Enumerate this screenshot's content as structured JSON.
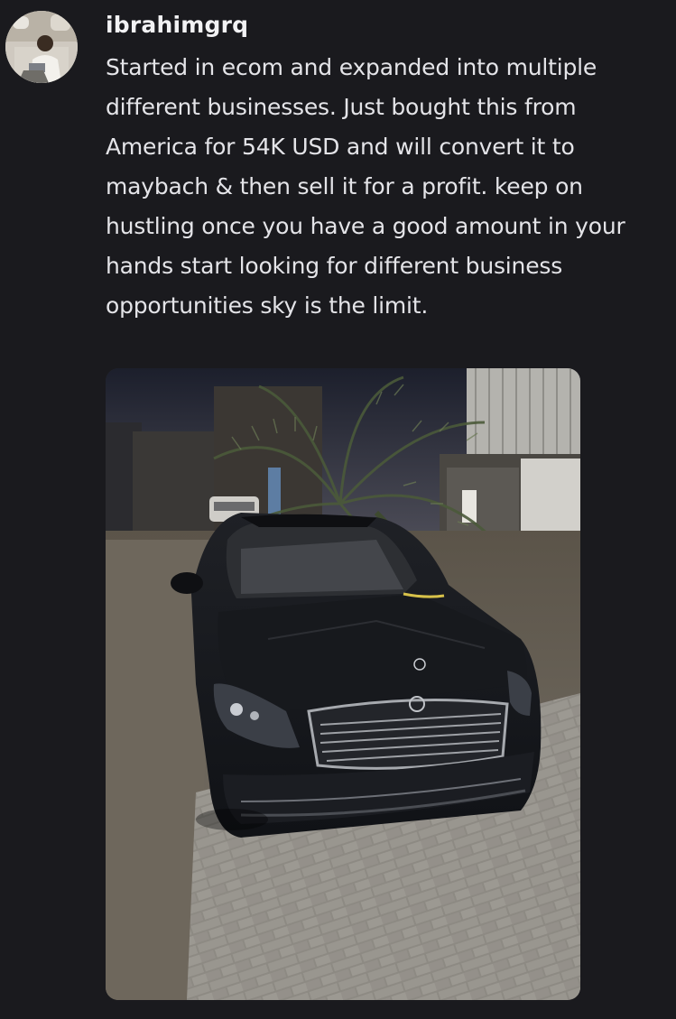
{
  "message": {
    "username": "ibrahimgrq",
    "text": "Started in ecom and expanded into multiple different businesses. Just bought this from America for 54K USD and will convert it to maybach & then sell it for a profit. keep on hustling once you have a good amount in your hands start looking for different business opportunities sky is the limit.",
    "attachment_alt": "Photo of a black Mercedes S-Class parked on a paved lot at night beside a palm tree"
  },
  "colors": {
    "background": "#1a1a1e",
    "username": "#f2f2f4",
    "text": "#e4e4e8"
  }
}
